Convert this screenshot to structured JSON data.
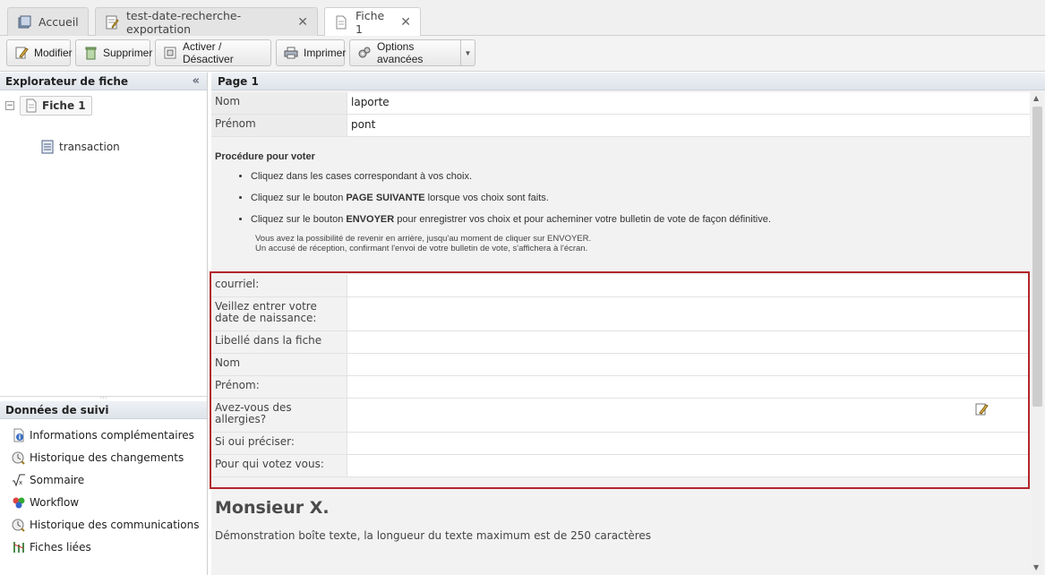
{
  "tabs": [
    {
      "label": "Accueil",
      "icon": "home-icon",
      "closable": false,
      "active": false
    },
    {
      "label": "test-date-recherche-exportation",
      "icon": "edit-form-icon",
      "closable": true,
      "active": false
    },
    {
      "label": "Fiche 1",
      "icon": "document-icon",
      "closable": true,
      "active": true
    }
  ],
  "toolbar": {
    "modifier": "Modifier",
    "supprimer": "Supprimer",
    "activer": "Activer / Désactiver",
    "imprimer": "Imprimer",
    "options": "Options avancées"
  },
  "explorer": {
    "title": "Explorateur de fiche",
    "root": "Fiche 1",
    "child": "transaction"
  },
  "tracking": {
    "title": "Données de suivi",
    "items": [
      {
        "label": "Informations complémentaires",
        "icon": "info-icon"
      },
      {
        "label": "Historique des changements",
        "icon": "history-icon"
      },
      {
        "label": "Sommaire",
        "icon": "sum-icon"
      },
      {
        "label": "Workflow",
        "icon": "workflow-icon"
      },
      {
        "label": "Historique des communications",
        "icon": "communications-icon"
      },
      {
        "label": "Fiches liées",
        "icon": "linked-records-icon"
      }
    ]
  },
  "page": {
    "title": "Page 1",
    "fields_top": [
      {
        "label": "Nom",
        "value": "laporte"
      },
      {
        "label": "Prénom",
        "value": "pont"
      }
    ],
    "procedure": {
      "title": "Procédure pour voter",
      "bullet1": "Cliquez dans les cases correspondant à vos choix.",
      "bullet2_pre": "Cliquez sur le bouton ",
      "bullet2_bold": "PAGE SUIVANTE",
      "bullet2_post": " lorsque vos choix sont faits.",
      "bullet3_pre": "Cliquez sur le bouton ",
      "bullet3_bold": "ENVOYER",
      "bullet3_post": " pour enregistrer vos choix et pour acheminer votre bulletin de vote de façon définitive.",
      "note1": "Vous avez la possibilité de revenir en arrière, jusqu'au moment de cliquer sur ENVOYER.",
      "note2": "Un accusé de réception, confirmant l'envoi de votre bulletin de vote, s'affichera à l'écran."
    },
    "fields": [
      {
        "label": "courriel:",
        "value": ""
      },
      {
        "label": "Veillez entrer votre date de naissance:",
        "value": ""
      },
      {
        "label": "Libellé dans la fiche",
        "value": ""
      },
      {
        "label": "Nom",
        "value": ""
      },
      {
        "label": "Prénom:",
        "value": ""
      },
      {
        "label": "Avez-vous des allergies?",
        "value": ""
      },
      {
        "label": "Si oui préciser:",
        "value": ""
      },
      {
        "label": "Pour qui votez vous:",
        "value": ""
      }
    ],
    "heading": "Monsieur X.",
    "description": "Démonstration boîte texte, la longueur du texte maximum est de 250 caractères"
  },
  "colors": {
    "highlight": "#b2262b",
    "panel_header": "#dfe4ea"
  }
}
